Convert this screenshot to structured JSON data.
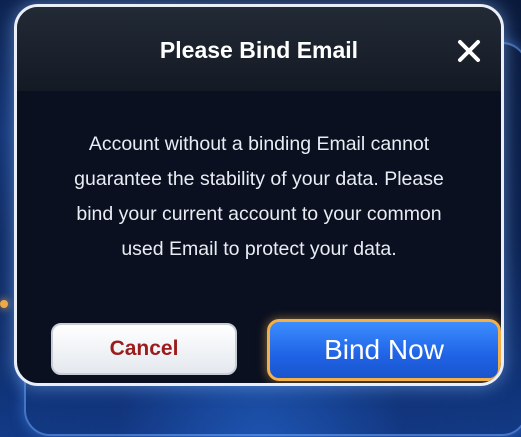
{
  "dialog": {
    "title": "Please Bind Email",
    "close_icon": "close-icon",
    "message_lines": [
      "Account without a binding Email cannot",
      "guarantee the stability of your data. Please",
      "bind your current account to your common",
      "used Email to protect your data."
    ],
    "cancel_label": "Cancel",
    "bind_label": "Bind Now"
  },
  "colors": {
    "dialog_border": "#e9eef8",
    "dialog_background": "#0a1020",
    "cancel_text": "#9b1c1c",
    "bind_button": "#1f63e6",
    "bind_border": "#f2b04a"
  }
}
